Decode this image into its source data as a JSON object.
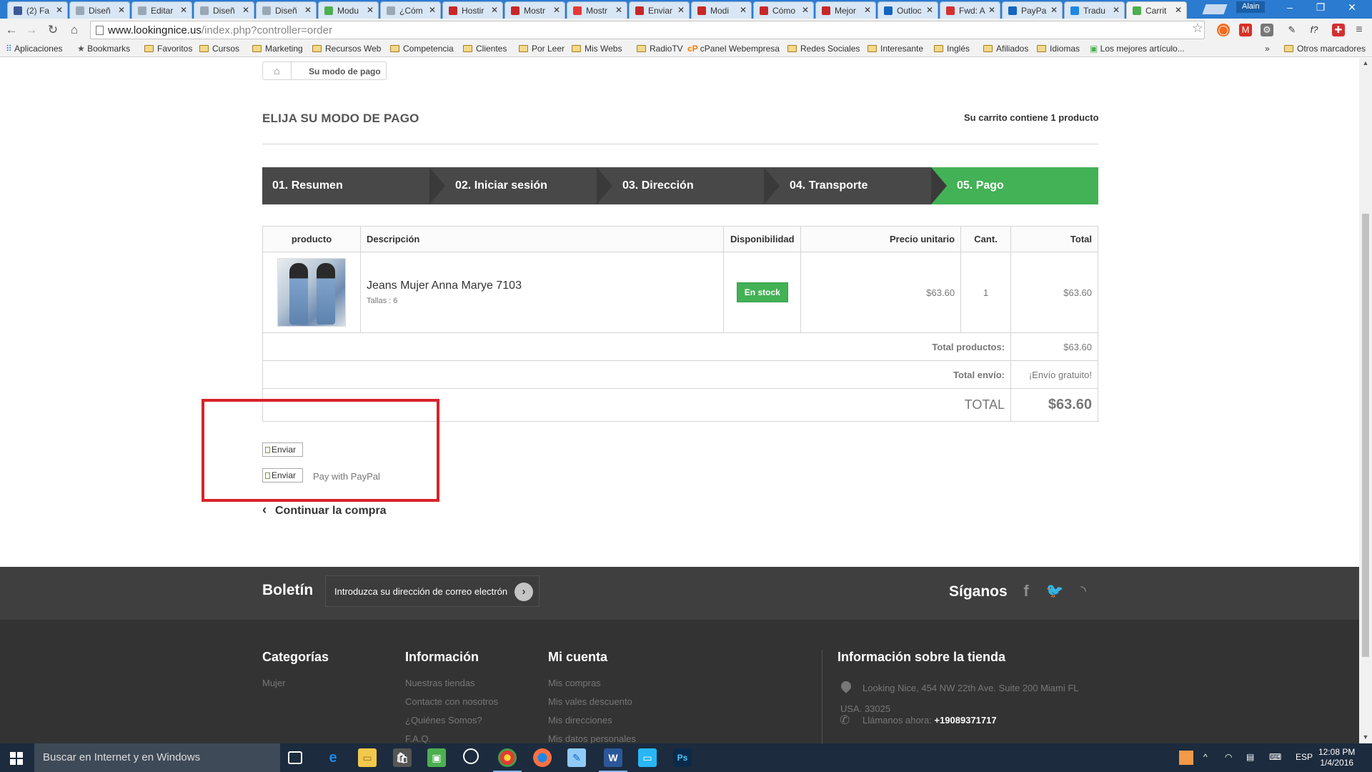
{
  "browser": {
    "tabs": [
      {
        "title": "(2) Fa",
        "color": "#3b5998"
      },
      {
        "title": "Diseñ",
        "color": "#9aa7b5"
      },
      {
        "title": "Editar",
        "color": "#9aa7b5"
      },
      {
        "title": "Diseñ",
        "color": "#9aa7b5"
      },
      {
        "title": "Diseñ",
        "color": "#9aa7b5"
      },
      {
        "title": "Modu",
        "color": "#4caf50"
      },
      {
        "title": "¿Cóm",
        "color": "#9aa7b5"
      },
      {
        "title": "Hostir",
        "color": "#c62828"
      },
      {
        "title": "Mostr",
        "color": "#c62828"
      },
      {
        "title": "Mostr",
        "color": "#e53935"
      },
      {
        "title": "Enviar",
        "color": "#c62828"
      },
      {
        "title": "Modi",
        "color": "#c62828"
      },
      {
        "title": "Cómo",
        "color": "#c62828"
      },
      {
        "title": "Mejor",
        "color": "#c62828"
      },
      {
        "title": "Outloc",
        "color": "#1565c0"
      },
      {
        "title": "Fwd: A",
        "color": "#d32f2f"
      },
      {
        "title": "PayPa",
        "color": "#1565c0"
      },
      {
        "title": "Tradu",
        "color": "#1e88e5"
      },
      {
        "title": "Carrit",
        "color": "#4caf50"
      }
    ],
    "profile_name": "Alain",
    "url_main": "www.lookingnice.us",
    "url_path": "/index.php?controller=order",
    "bookmarks": [
      {
        "label": "Aplicaciones",
        "kind": "apps"
      },
      {
        "label": "Bookmarks",
        "kind": "star"
      },
      {
        "label": "Favoritos",
        "kind": "folder"
      },
      {
        "label": "Cursos",
        "kind": "folder"
      },
      {
        "label": "Marketing",
        "kind": "folder"
      },
      {
        "label": "Recursos Web",
        "kind": "folder"
      },
      {
        "label": "Competencia",
        "kind": "folder"
      },
      {
        "label": "Clientes",
        "kind": "folder"
      },
      {
        "label": "Por Leer",
        "kind": "folder"
      },
      {
        "label": "Mis Webs",
        "kind": "folder"
      },
      {
        "label": "RadioTV",
        "kind": "folder"
      },
      {
        "label": "cPanel Webempresa",
        "kind": "cpanel"
      },
      {
        "label": "Redes Sociales",
        "kind": "folder"
      },
      {
        "label": "Interesante",
        "kind": "folder"
      },
      {
        "label": "Inglés",
        "kind": "folder"
      },
      {
        "label": "Afiliados",
        "kind": "folder"
      },
      {
        "label": "Idiomas",
        "kind": "folder"
      },
      {
        "label": "Los mejores artículo...",
        "kind": "page"
      }
    ],
    "bookmarks_more": "»",
    "bookmarks_other": "Otros marcadores"
  },
  "page": {
    "breadcrumb": "Su modo de pago",
    "heading": "ELIJA SU MODO DE PAGO",
    "cart_count": "Su carrito contiene 1 producto",
    "steps": [
      "01. Resumen",
      "02. Iniciar sesión",
      "03. Dirección",
      "04. Transporte",
      "05. Pago"
    ],
    "table": {
      "headers": [
        "producto",
        "Descripción",
        "Disponibilidad",
        "Precio unitario",
        "Cant.",
        "Total"
      ],
      "row": {
        "name": "Jeans Mujer Anna Marye 7103",
        "attributes": "Tallas : 6",
        "availability": "En stock",
        "unit_price": "$63.60",
        "quantity": "1",
        "total": "$63.60"
      },
      "total_products_label": "Total productos:",
      "total_products_value": "$63.60",
      "shipping_label": "Total envío:",
      "shipping_value": "¡Envío gratuito!",
      "grand_label": "TOTAL",
      "grand_value": "$63.60"
    },
    "payment_alt_1": "Enviar",
    "payment_alt_2": "Enviar",
    "paypal_text": "Pay with PayPal",
    "continue": "Continuar la compra"
  },
  "footer": {
    "newsletter_title": "Boletín",
    "newsletter_placeholder": "Introduzca su dirección de correo electrón",
    "follow_title": "Síganos",
    "columns": [
      {
        "title": "Categorías",
        "links": [
          "Mujer"
        ]
      },
      {
        "title": "Información",
        "links": [
          "Nuestras tiendas",
          "Contacte con nosotros",
          "¿Quiénes Somos?",
          "F.A.Q."
        ]
      },
      {
        "title": "Mi cuenta",
        "links": [
          "Mis compras",
          "Mis vales descuento",
          "Mis direcciones",
          "Mis datos personales"
        ]
      }
    ],
    "store_title": "Información sobre la tienda",
    "store_address_line1": "Looking Nice, 454 NW 22th Ave. Suite 200 Miami FL",
    "store_address_line2": "USA. 33025",
    "store_phone_label": "Llámanos ahora:",
    "store_phone": "+19089371717"
  },
  "taskbar": {
    "search_placeholder": "Buscar en Internet y en Windows",
    "language": "ESP",
    "time": "12:08 PM",
    "date": "1/4/2016"
  },
  "colors": {
    "accent_green": "#43b155",
    "step_dark": "#484848",
    "highlight_red": "#d8232a",
    "footer_dark": "#333333"
  }
}
